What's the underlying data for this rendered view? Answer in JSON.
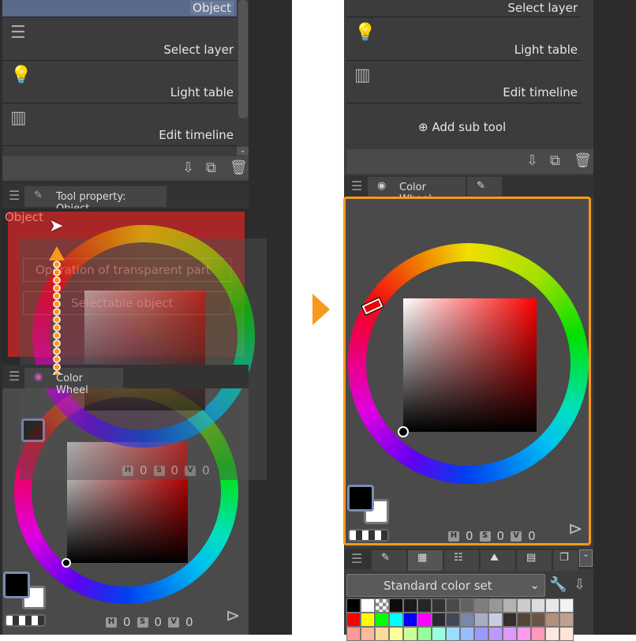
{
  "left": {
    "subtools": [
      {
        "label": "Object",
        "icon": "object-icon"
      },
      {
        "label": "Select layer",
        "icon": "select-layer-icon"
      },
      {
        "label": "Light table",
        "icon": "light-table-icon"
      },
      {
        "label": "Edit timeline",
        "icon": "edit-timeline-icon"
      }
    ],
    "tool_property_tab": "Tool property: Object",
    "tool_property_title": "Object",
    "transparent_dropdown": "Operation of transparent part",
    "selectable_dropdown": "Selectable object",
    "color_wheel_tab": "Color Wheel",
    "hsv": {
      "h_label": "H",
      "h": "0",
      "s_label": "S",
      "s": "0",
      "v_label": "V",
      "v": "0"
    }
  },
  "right": {
    "subtools": [
      {
        "label": "Select layer"
      },
      {
        "label": "Light table",
        "icon": "light-table-icon"
      },
      {
        "label": "Edit timeline",
        "icon": "edit-timeline-icon"
      }
    ],
    "add_sub_tool": "Add sub tool",
    "color_wheel_tab": "Color Wheel",
    "hsv": {
      "h_label": "H",
      "h": "0",
      "s_label": "S",
      "s": "0",
      "v_label": "V",
      "v": "0"
    },
    "color_set": "Standard color set",
    "palette": [
      [
        "#000000",
        "#ffffff",
        "checker",
        "#0c0c0c",
        "#1a1a1a",
        "#262626",
        "#333333",
        "#4a4a4a",
        "#626262",
        "#7f7f7f",
        "#989898",
        "#b3b3b3",
        "#cccccc",
        "#dcdcdc",
        "#e8e8e8",
        "#f2f2f2"
      ],
      [
        "#ff0000",
        "#ffff00",
        "#00ff00",
        "#00ffff",
        "#0000ff",
        "#ff00ff",
        "#2a2b30",
        "#444855",
        "#7788a8",
        "#a6aec8",
        "#c8cde4",
        "#332f2a",
        "#544637",
        "#6a5544",
        "#b48e78",
        "#c0a090"
      ],
      [
        "#ff9999",
        "#ffbb99",
        "#ffd999",
        "#ffff99",
        "#ccff99",
        "#99ff99",
        "#99ffe0",
        "#99ddff",
        "#99bbff",
        "#9999ff",
        "#bb99ff",
        "#dd99ff",
        "#ff99ee",
        "#ff99bb",
        "#fce8e2",
        "#ffe4d8"
      ]
    ]
  },
  "colors": {
    "accent": "#f79a1b",
    "highlight": "#b22222",
    "selection": "#5a6a8a"
  }
}
